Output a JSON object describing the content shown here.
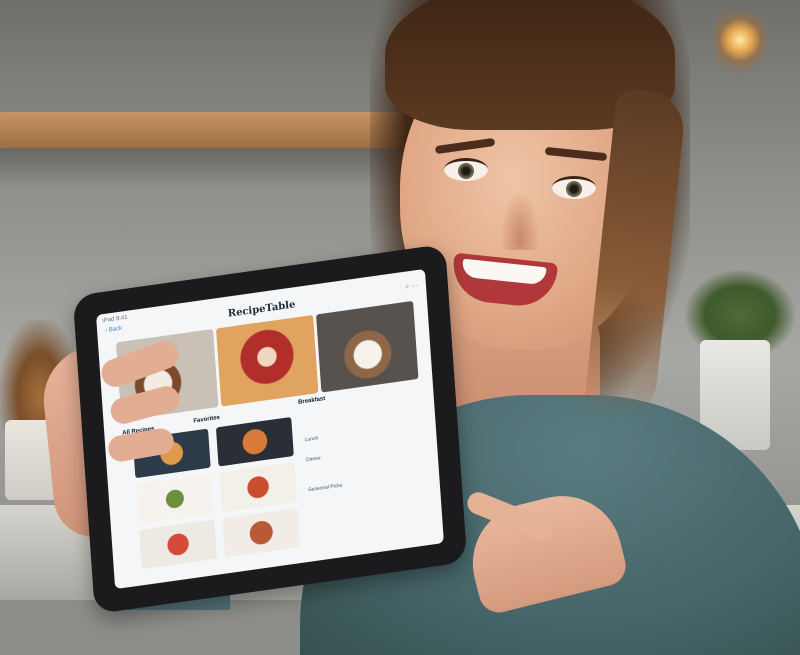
{
  "tablet_screen": {
    "status": "iPad 9:41",
    "back": "‹ Back",
    "title": "RecipeTable",
    "icons": "⌕  ⋯",
    "section_left": "All Recipes",
    "section_mid": "Favorites",
    "section_right": "Breakfast",
    "notes": [
      "Lunch",
      "Dinner",
      "Seasonal Picks"
    ]
  }
}
